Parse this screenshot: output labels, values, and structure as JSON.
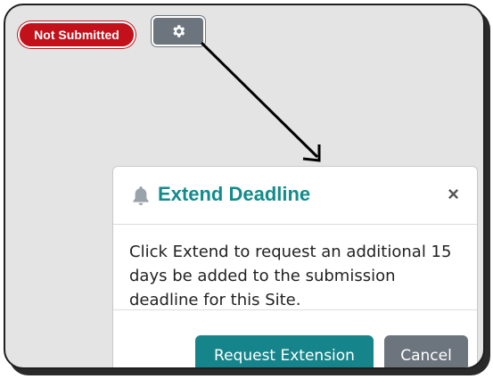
{
  "status_badge": {
    "label": "Not Submitted",
    "color": "#c2111a"
  },
  "settings_button": {
    "icon": "gear-icon"
  },
  "modal": {
    "icon": "bell-icon",
    "title": "Extend Deadline",
    "close_label": "×",
    "body": "Click Extend to request an additional 15 days be added to the submission deadline for this Site.",
    "primary_button": "Request Extension",
    "secondary_button": "Cancel",
    "accent_color": "#138b8b"
  }
}
